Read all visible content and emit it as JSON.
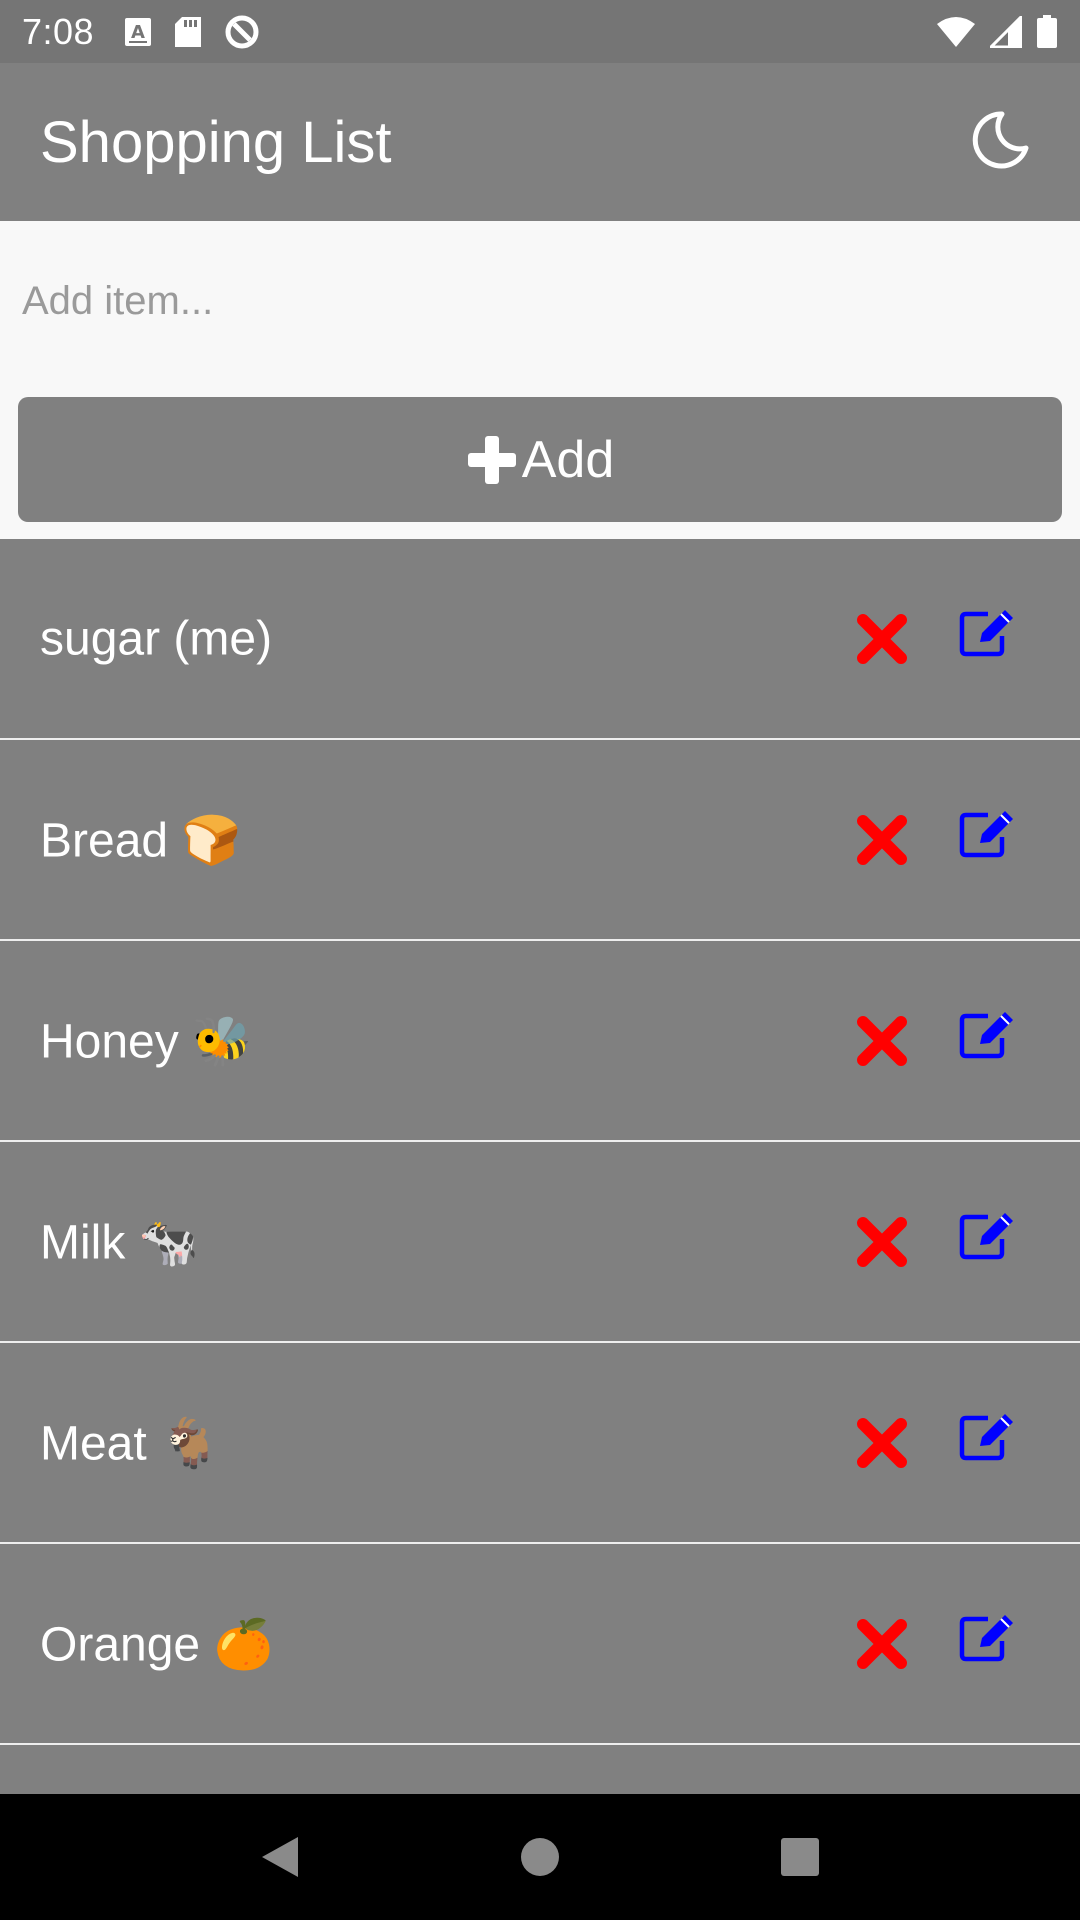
{
  "status_bar": {
    "time": "7:08",
    "left_icons": [
      "font-a-icon",
      "sd-card-icon",
      "data-saver-icon"
    ],
    "right_icons": [
      "wifi-icon",
      "cell-signal-icon",
      "battery-icon"
    ]
  },
  "app_bar": {
    "title": "Shopping List",
    "theme_icon": "moon-icon"
  },
  "add_form": {
    "placeholder": "Add item...",
    "value": "",
    "button_label": "Add",
    "button_icon": "plus-icon"
  },
  "items": [
    {
      "label": "sugar (me)"
    },
    {
      "label": "Bread 🍞"
    },
    {
      "label": "Honey 🐝"
    },
    {
      "label": "Milk 🐄"
    },
    {
      "label": "Meat 🐐"
    },
    {
      "label": "Orange  🍊"
    }
  ],
  "colors": {
    "background": "#808080",
    "status_bar": "#757575",
    "input_bg": "#f8f8f8",
    "delete": "#ff0000",
    "edit": "#0000ff",
    "divider": "#eeeeee",
    "nav_bar": "#000000"
  },
  "nav_bar": {
    "buttons": [
      "back-icon",
      "home-icon",
      "recents-icon"
    ]
  }
}
